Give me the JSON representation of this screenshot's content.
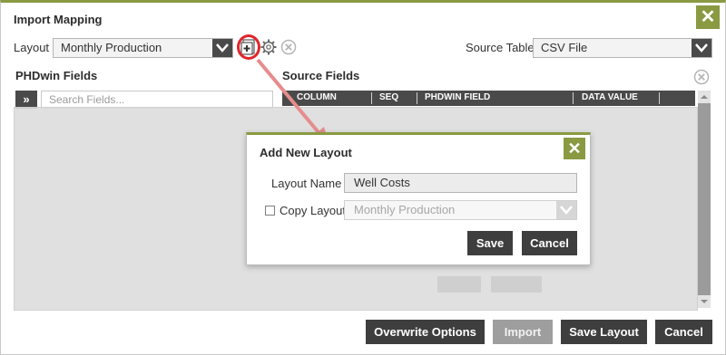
{
  "window": {
    "title": "Import Mapping",
    "close_label": "✕"
  },
  "top_controls": {
    "layout_label": "Layout",
    "layout_value": "Monthly Production",
    "source_table_label": "Source Table",
    "source_table_value": "CSV File"
  },
  "phdwin_panel": {
    "heading": "PHDwin Fields",
    "expand_label": "»",
    "search_placeholder": "Search Fields..."
  },
  "source_panel": {
    "heading": "Source Fields",
    "columns": [
      "COLUMN",
      "SEQ",
      "PHDWIN FIELD",
      "DATA VALUE"
    ]
  },
  "dialog": {
    "title": "Add New Layout",
    "close_label": "✕",
    "layout_name_label": "Layout Name",
    "layout_name_value": "Well Costs",
    "copy_layout_label": "Copy Layout",
    "copy_layout_checked": false,
    "copy_layout_value": "Monthly Production",
    "save_label": "Save",
    "cancel_label": "Cancel"
  },
  "footer": {
    "overwrite_label": "Overwrite Options",
    "import_label": "Import",
    "save_layout_label": "Save Layout",
    "cancel_label": "Cancel"
  },
  "colors": {
    "accent": "#8a9a42",
    "highlight": "#e0262b",
    "dark_button": "#3e3e3e"
  }
}
